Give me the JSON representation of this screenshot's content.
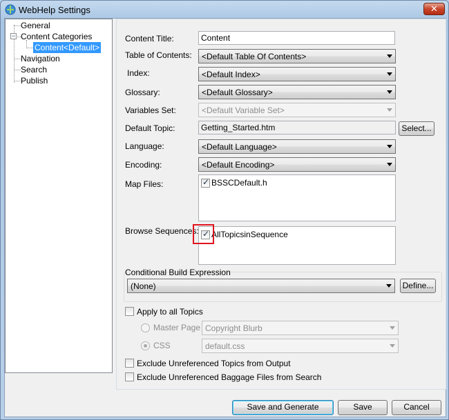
{
  "window": {
    "title": "WebHelp Settings",
    "close_label": "✕"
  },
  "tree": {
    "items": [
      {
        "label": "General"
      },
      {
        "label": "Content Categories",
        "expander": "−"
      },
      {
        "label": "Content<Default>"
      },
      {
        "label": "Navigation"
      },
      {
        "label": "Search"
      },
      {
        "label": "Publish"
      }
    ]
  },
  "form": {
    "content_title_label": "Content Title:",
    "content_title_value": "Content",
    "toc_label": "Table of Contents:",
    "toc_value": "<Default Table Of Contents>",
    "index_label": "Index:",
    "index_value": "<Default Index>",
    "glossary_label": "Glossary:",
    "glossary_value": "<Default Glossary>",
    "variables_label": "Variables Set:",
    "variables_value": "<Default Variable Set>",
    "default_topic_label": "Default Topic:",
    "default_topic_value": "Getting_Started.htm",
    "select_button": "Select...",
    "language_label": "Language:",
    "language_value": "<Default Language>",
    "encoding_label": "Encoding:",
    "encoding_value": "<Default Encoding>",
    "map_files_label": "Map Files:",
    "map_files": [
      {
        "label": "BSSCDefault.h",
        "checked": true
      }
    ],
    "browse_label": "Browse Sequences:",
    "browse_sequences": [
      {
        "label": "AllTopicsinSequence",
        "checked": true
      }
    ],
    "cbe_label": "Conditional Build Expression",
    "cbe_value": "(None)",
    "define_button": "Define...",
    "apply_all_label": "Apply to all Topics",
    "master_page_label": "Master Page",
    "master_page_value": "Copyright Blurb",
    "css_label": "CSS",
    "css_value": "default.css",
    "exclude_topics_label": "Exclude Unreferenced Topics from Output",
    "exclude_baggage_label": "Exclude Unreferenced Baggage Files from Search"
  },
  "buttons": {
    "save_generate": "Save and Generate",
    "save": "Save",
    "cancel": "Cancel"
  },
  "colors": {
    "highlight": "#e0141e",
    "selection": "#3399ff"
  }
}
